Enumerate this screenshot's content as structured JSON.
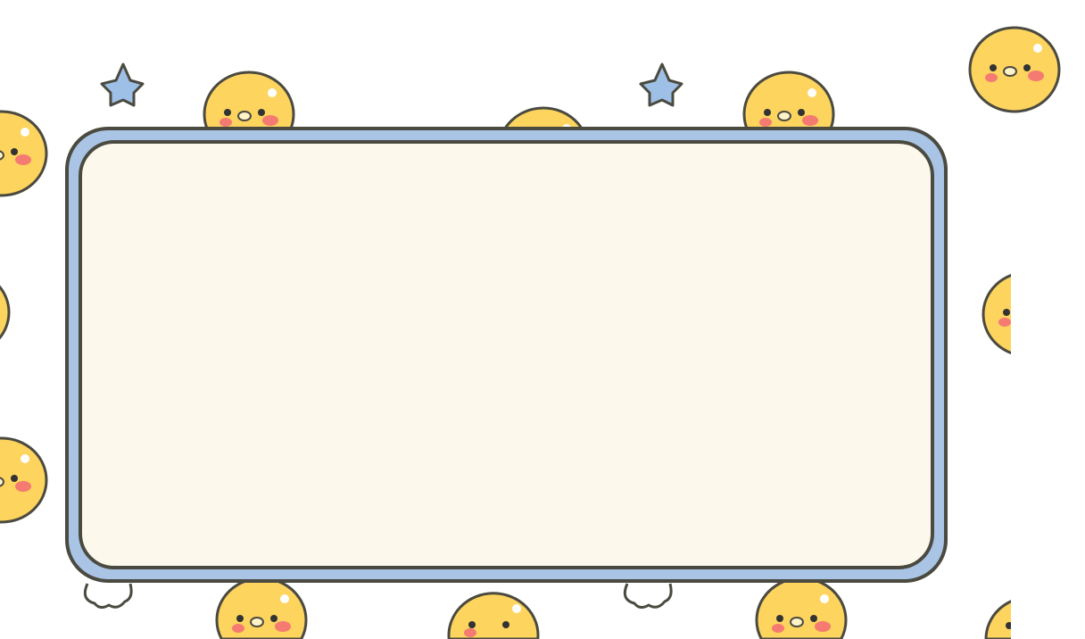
{
  "colors": {
    "background": "#ffffff",
    "frame_outer": "#a9c4e4",
    "frame_inner": "#fcf8ec",
    "outline": "#4b4a40",
    "duck_body": "#fdd45e",
    "duck_cheek": "#f47a72",
    "star": "#9fc0e6"
  },
  "icons": [
    "duck-icon",
    "star-icon",
    "hand-icon"
  ]
}
